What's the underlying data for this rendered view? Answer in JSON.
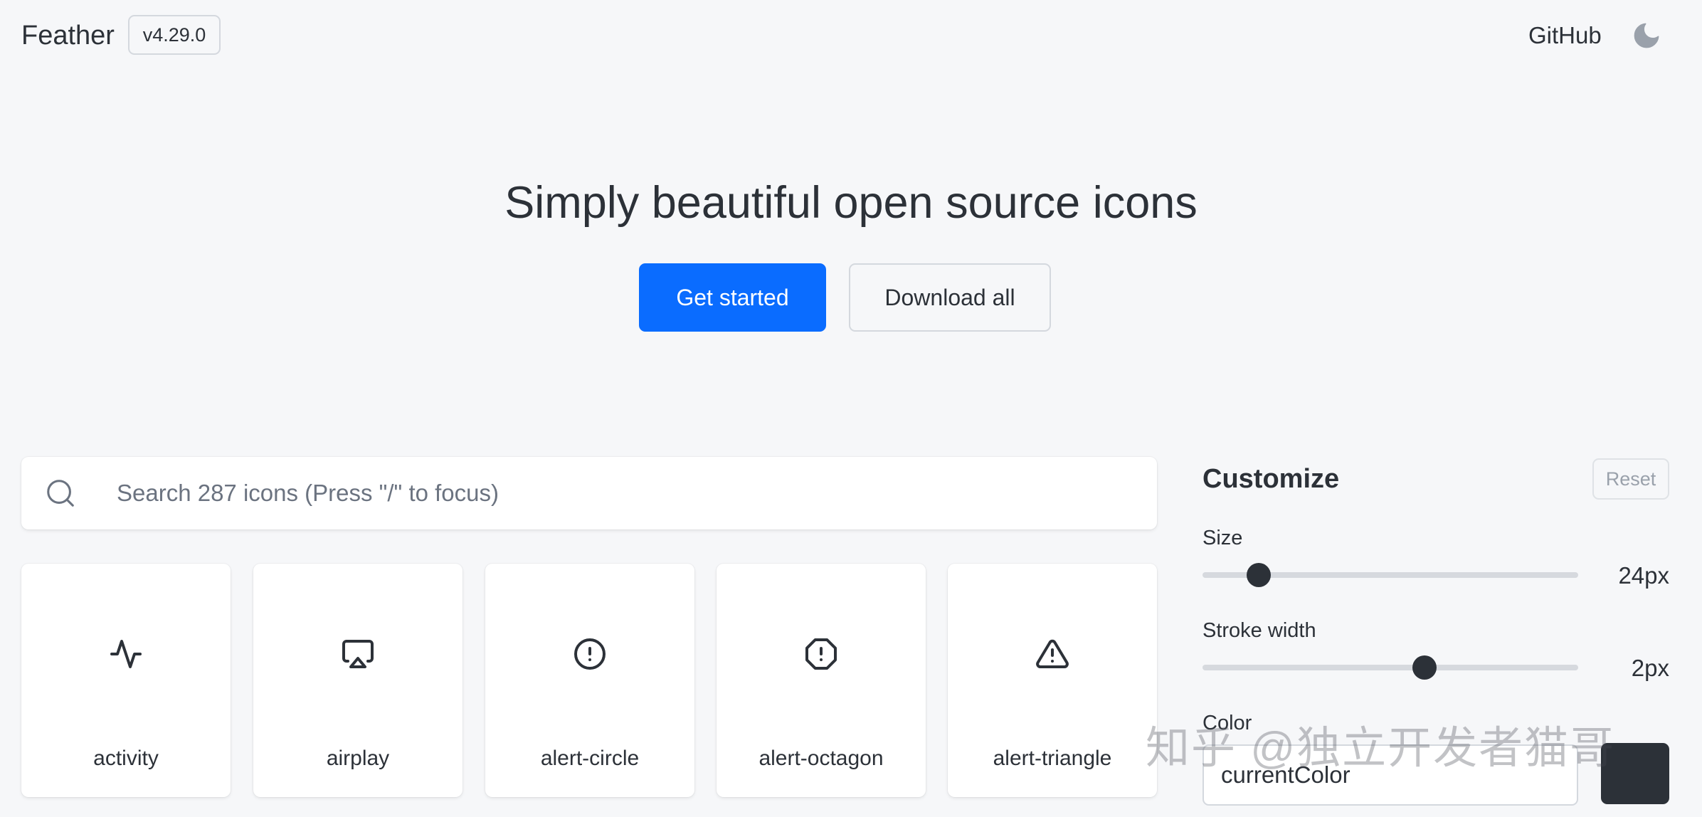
{
  "header": {
    "brand": "Feather",
    "version": "v4.29.0",
    "github_label": "GitHub",
    "theme_toggle_icon": "moon-icon"
  },
  "hero": {
    "title": "Simply beautiful open source icons",
    "primary_button": "Get started",
    "secondary_button": "Download all"
  },
  "search": {
    "placeholder": "Search 287 icons (Press \"/\" to focus)",
    "value": "",
    "icon": "search-icon"
  },
  "icons": [
    {
      "name": "activity",
      "icon": "activity-icon"
    },
    {
      "name": "airplay",
      "icon": "airplay-icon"
    },
    {
      "name": "alert-circle",
      "icon": "alert-circle-icon"
    },
    {
      "name": "alert-octagon",
      "icon": "alert-octagon-icon"
    },
    {
      "name": "alert-triangle",
      "icon": "alert-triangle-icon"
    }
  ],
  "customize": {
    "title": "Customize",
    "reset_label": "Reset",
    "size": {
      "label": "Size",
      "value_text": "24px",
      "level": 0.15
    },
    "stroke": {
      "label": "Stroke width",
      "value_text": "2px",
      "level": 0.59
    },
    "color": {
      "label": "Color",
      "value": "currentColor",
      "swatch": "#2c3138"
    }
  },
  "watermark": "知乎 @独立开发者猫哥",
  "colors": {
    "background": "#f6f7f9",
    "accent": "#0a6cff",
    "text": "#2c3138"
  }
}
